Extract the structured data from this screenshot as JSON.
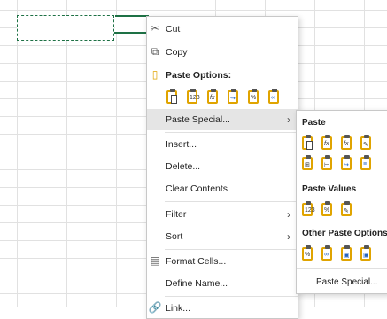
{
  "menu": {
    "cut": "Cut",
    "copy": "Copy",
    "paste_options": "Paste Options:",
    "paste_special": "Paste Special...",
    "insert": "Insert...",
    "delete": "Delete...",
    "clear_contents": "Clear Contents",
    "filter": "Filter",
    "sort": "Sort",
    "format_cells": "Format Cells...",
    "define_name": "Define Name...",
    "link": "Link...",
    "paste_icons": [
      "paste",
      "paste-values-123",
      "paste-formulas-fx",
      "paste-transpose",
      "paste-formatting",
      "paste-link"
    ]
  },
  "submenu": {
    "paste_header": "Paste",
    "paste_values_header": "Paste Values",
    "other_header": "Other Paste Options",
    "paste_special": "Paste Special..."
  },
  "colors": {
    "accent": "#1e7145",
    "clipboard": "#e0a400"
  }
}
